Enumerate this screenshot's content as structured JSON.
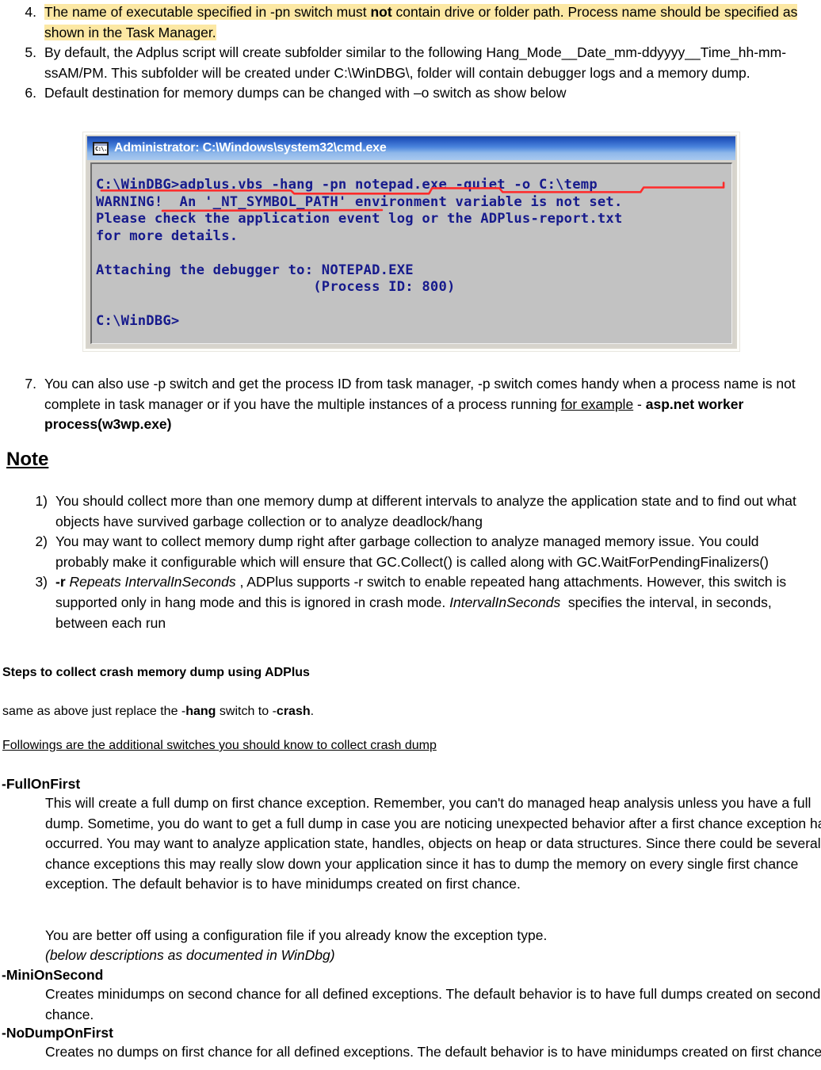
{
  "document": {
    "numbered_items": [
      {
        "num": "4.",
        "highlighted": true,
        "segments": [
          {
            "text": "The name of executable specified in -pn switch must ",
            "style": "normal"
          },
          {
            "text": "not",
            "style": "bold"
          },
          {
            "text": " contain drive or folder path. Process name should be specified as shown in the Task Manager.",
            "style": "normal"
          }
        ]
      },
      {
        "num": "5.",
        "highlighted": false,
        "segments": [
          {
            "text": "By default, the Adplus script will create subfolder similar to the following Hang_Mode__Date_mm-ddyyyy__Time_hh-mm-ssAM/PM. This subfolder will be created under C:\\WinDBG\\, folder will contain debugger logs and a memory dump.",
            "style": "normal"
          }
        ]
      },
      {
        "num": "6.",
        "highlighted": false,
        "segments": [
          {
            "text": "Default destination for memory dumps can be changed with –o switch as show below",
            "style": "normal"
          }
        ]
      }
    ],
    "item7": {
      "num": "7.",
      "segments": [
        {
          "text": "You can also use -p switch and get the process ID from task manager, -p switch comes handy when a process name is not complete in task manager or if you have the multiple instances of a process running ",
          "style": "normal"
        },
        {
          "text": "for example",
          "style": "underline"
        },
        {
          "text": " - ",
          "style": "normal"
        },
        {
          "text": "asp.net worker process(w3wp.exe)",
          "style": "bold"
        }
      ]
    },
    "note_heading": "Note",
    "note_items": [
      {
        "num": "1)",
        "segments": [
          {
            "text": "You should collect more than one memory dump at different intervals to analyze the application state and to find out what objects have survived garbage collection or to analyze deadlock/hang",
            "style": "normal"
          }
        ]
      },
      {
        "num": "2)",
        "segments": [
          {
            "text": "You may want to collect memory dump right after garbage collection to analyze managed memory issue. You could probably make it configurable which will ensure that GC.Collect() is called along with GC.WaitForPendingFinalizers()",
            "style": "normal"
          }
        ]
      },
      {
        "num": "3)",
        "segments": [
          {
            "text": "-r",
            "style": "bold"
          },
          {
            "text": " ",
            "style": "normal"
          },
          {
            "text": "Repeats IntervalInSeconds",
            "style": "italic"
          },
          {
            "text": " , ADPlus supports -r switch to enable repeated hang attachments. However, this switch is supported only in hang mode and this is ignored in crash mode. ",
            "style": "normal"
          },
          {
            "text": "IntervalInSeconds",
            "style": "italic"
          },
          {
            "text": "  specifies the interval, in seconds, between each run",
            "style": "normal"
          }
        ]
      }
    ],
    "crash_section": {
      "heading": "Steps to collect crash memory dump using ADPlus",
      "same_as_above": [
        {
          "text": "same as above just replace the -",
          "style": "normal"
        },
        {
          "text": "hang",
          "style": "bold"
        },
        {
          "text": " switch to -",
          "style": "normal"
        },
        {
          "text": "crash",
          "style": "bold"
        },
        {
          "text": ".",
          "style": "normal"
        }
      ],
      "followings_line": "Followings are the additional switches you should know  to collect crash dump"
    },
    "switches": [
      {
        "name": "-FullOnFirst",
        "paragraphs": [
          "This will create a full dump on first chance exception. Remember, you can't do managed heap analysis unless you have a full dump. Sometime, you do want to get a full dump in case you are noticing unexpected behavior after a first chance exception has occurred. You may want to analyze application state, handles, objects on heap or data structures. Since there could be several first chance exceptions this may really slow down your application since it has to dump the memory on every single first chance exception.  The default behavior is to have minidumps created on first chance."
        ],
        "extra_paragraph": "You are better off using a configuration file if you already know the exception type.",
        "extra_italic": "(below descriptions as documented in WinDbg)"
      },
      {
        "name": "-MiniOnSecond",
        "paragraphs": [
          "Creates minidumps on second chance for all defined exceptions. The default behavior is to have full dumps created on second chance."
        ]
      },
      {
        "name": "-NoDumpOnFirst",
        "paragraphs": [
          "Creates no dumps on first chance for all defined exceptions. The default behavior is to have minidumps created on first chance."
        ]
      }
    ]
  },
  "cmd_window": {
    "title": "Administrator: C:\\Windows\\system32\\cmd.exe",
    "icon": "cmd-console-icon",
    "lines": [
      "C:\\WinDBG>adplus.vbs -hang -pn notepad.exe -quiet -o C:\\temp",
      "WARNING!  An '_NT_SYMBOL_PATH' environment variable is not set.",
      "Please check the application event log or the ADPlus-report.txt",
      "for more details.",
      "",
      "Attaching the debugger to: NOTEPAD.EXE",
      "                          (Process ID: 800)",
      "",
      "C:\\WinDBG>"
    ],
    "annotation": "red-underline-on-command-line"
  },
  "colors": {
    "highlight": "#fce8a4",
    "cmd_text": "#161a8c",
    "cmd_background": "#c2c2c2",
    "titlebar_blue": "#2a5dc4",
    "annotation_red": "#ff2a2a"
  }
}
